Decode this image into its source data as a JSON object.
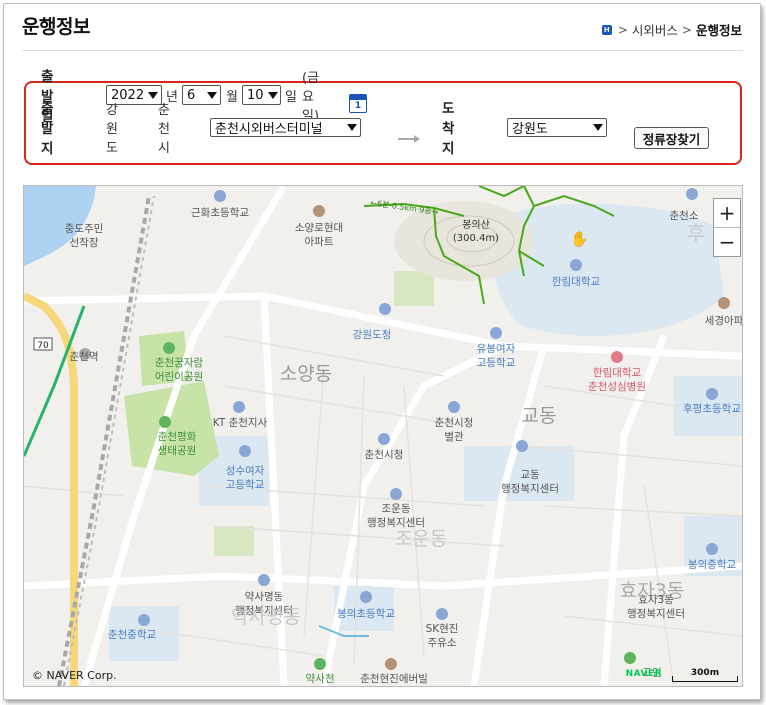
{
  "page": {
    "title": "운행정보",
    "breadcrumb": [
      "시외버스",
      "운행정보"
    ]
  },
  "form": {
    "departure_date_label": "출발일",
    "year": "2022",
    "year_unit": "년",
    "month": "6",
    "month_unit": "월",
    "day": "10",
    "day_unit": "일",
    "weekday": "(금요일)",
    "calendar_icon_day": "1",
    "departure_label": "출발지",
    "departure_region": "강원도",
    "departure_city": "춘천시",
    "departure_terminal": "춘천시외버스터미널",
    "arrival_label": "도착지",
    "arrival_region": "강원도",
    "search_button": "정류장찾기"
  },
  "map": {
    "labels": {
      "a1": "중도주민",
      "a2": "선착장",
      "b": "근화초등학교",
      "c1": "소양로현대",
      "c2": "아파트",
      "d": "←6분·0.5km·9층→",
      "e1": "봉의산",
      "e2": "(300.4m)",
      "f": "춘천소",
      "g": "후",
      "h": "한림대학교",
      "i": "강원도청",
      "j": "세경아파",
      "k1": "유봉여자",
      "k2": "고등학교",
      "l": "춘천역",
      "m1": "춘천꿈자람",
      "m2": "어린이공원",
      "n": "소양동",
      "o1": "한림대학교",
      "o2": "춘천성심병원",
      "p": "후평초등학교",
      "q": "KT 춘천지사",
      "r1": "춘천시청",
      "r2": "별관",
      "s": "교동",
      "t1": "춘천평화",
      "t2": "생태공원",
      "u": "춘천시청",
      "v1": "교동",
      "v2": "행정복지센터",
      "w1": "성수여자",
      "w2": "고등학교",
      "x1": "조운동",
      "x2": "행정복지센터",
      "y": "조운동",
      "z": "봉의중학교",
      "aa": "효자3동",
      "ab1": "약사명동",
      "ab2": "행정복지센터",
      "ac": "약사명동",
      "ad": "봉의초등학교",
      "ae1": "효자3동",
      "ae2": "행정복지센터",
      "af1": "SK현진",
      "af2": "주유소",
      "ag": "춘천중학교",
      "ah": "약사천",
      "ai": "춘천현진에버빌",
      "aj": "70",
      "ak": "고인"
    },
    "zoom_in": "+",
    "zoom_out": "−",
    "copyright": "© NAVER Corp.",
    "logo": "NAVER",
    "scale": "300m"
  },
  "colors": {
    "accent_red": "#d9261c",
    "brand_blue": "#1a56b8",
    "naver_green": "#03c75a",
    "trail_green": "#4aa81c",
    "park_green": "#c7e3a8",
    "water_blue": "#aed3f2",
    "campus_blue": "#dce8f1"
  }
}
